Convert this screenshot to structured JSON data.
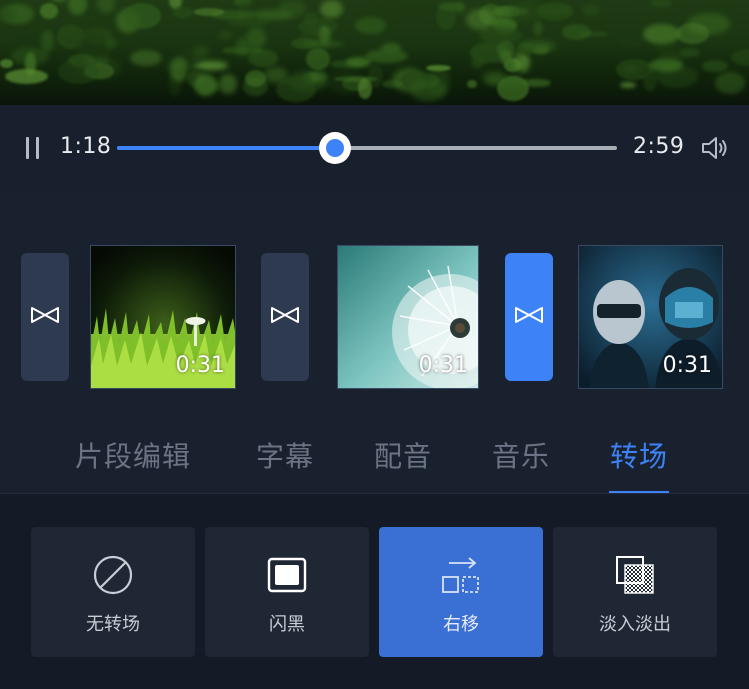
{
  "player": {
    "current_time": "1:18",
    "total_time": "2:59",
    "progress_fraction": 0.4358
  },
  "timeline": {
    "clips": [
      {
        "duration": "0:31",
        "thumbnail": "grass-mushroom"
      },
      {
        "duration": "0:31",
        "thumbnail": "dandelion"
      },
      {
        "duration": "0:31",
        "thumbnail": "helmets"
      }
    ],
    "transitions": [
      {
        "icon": "bowtie-transition-icon",
        "active": false
      },
      {
        "icon": "bowtie-transition-icon",
        "active": false
      },
      {
        "icon": "bowtie-transition-icon",
        "active": true
      }
    ]
  },
  "tabs": [
    {
      "label": "片段编辑",
      "active": false
    },
    {
      "label": "字幕",
      "active": false
    },
    {
      "label": "配音",
      "active": false
    },
    {
      "label": "音乐",
      "active": false
    },
    {
      "label": "转场",
      "active": true
    }
  ],
  "transition_options": [
    {
      "label": "无转场",
      "icon": "no-transition-icon",
      "selected": false
    },
    {
      "label": "闪黑",
      "icon": "flash-black-icon",
      "selected": false
    },
    {
      "label": "右移",
      "icon": "move-right-icon",
      "selected": true
    },
    {
      "label": "淡入淡出",
      "icon": "fade-icon",
      "selected": false
    }
  ],
  "colors": {
    "accent": "#3d82f6",
    "selected_option": "#3a6fd4",
    "background": "#141a26"
  }
}
